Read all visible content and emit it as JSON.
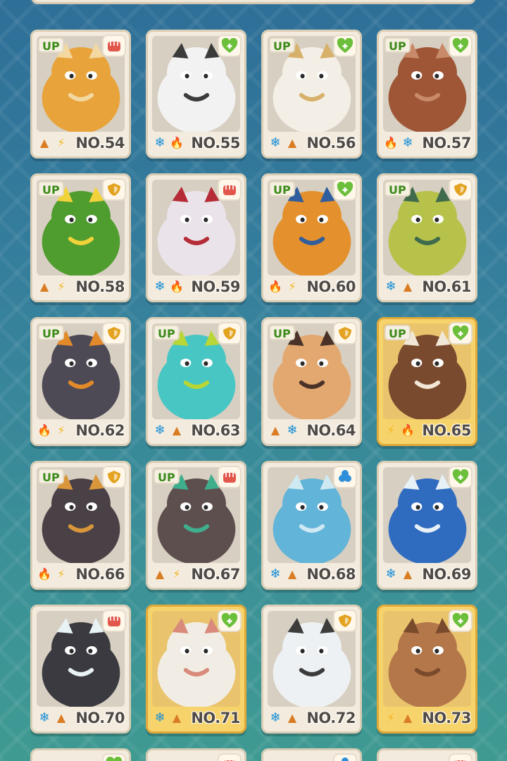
{
  "cards": [
    {
      "num": "NO.54",
      "up": "UP",
      "type": "fist",
      "elems": [
        "ground",
        "electric"
      ],
      "gold": false,
      "body": "#e8a33a",
      "accent": "#f3d8a1"
    },
    {
      "num": "NO.55",
      "up": "",
      "type": "heart",
      "elems": [
        "ice",
        "fire"
      ],
      "gold": false,
      "body": "#f2f2f2",
      "accent": "#3b3b3b"
    },
    {
      "num": "NO.56",
      "up": "UP",
      "type": "heart",
      "elems": [
        "ice",
        "ground"
      ],
      "gold": false,
      "body": "#f4efe6",
      "accent": "#d7b06a"
    },
    {
      "num": "NO.57",
      "up": "UP",
      "type": "heart",
      "elems": [
        "fire",
        "ice"
      ],
      "gold": false,
      "body": "#9e5636",
      "accent": "#c98a6a"
    },
    {
      "num": "NO.58",
      "up": "UP",
      "type": "shield",
      "elems": [
        "ground",
        "electric"
      ],
      "gold": false,
      "body": "#4f9c2f",
      "accent": "#f2d23a"
    },
    {
      "num": "NO.59",
      "up": "",
      "type": "fist",
      "elems": [
        "ice",
        "fire"
      ],
      "gold": false,
      "body": "#eae4ea",
      "accent": "#b52b36"
    },
    {
      "num": "NO.60",
      "up": "UP",
      "type": "heart",
      "elems": [
        "fire",
        "electric"
      ],
      "gold": false,
      "body": "#e4902c",
      "accent": "#2f5d9d"
    },
    {
      "num": "NO.61",
      "up": "UP",
      "type": "shield",
      "elems": [
        "ice",
        "ground"
      ],
      "gold": false,
      "body": "#b6c24a",
      "accent": "#3f6a4c"
    },
    {
      "num": "NO.62",
      "up": "UP",
      "type": "shield",
      "elems": [
        "fire",
        "electric"
      ],
      "gold": false,
      "body": "#4d4a55",
      "accent": "#e28a2a"
    },
    {
      "num": "NO.63",
      "up": "UP",
      "type": "shield",
      "elems": [
        "ice",
        "ground"
      ],
      "gold": false,
      "body": "#48c6c4",
      "accent": "#b8d636"
    },
    {
      "num": "NO.64",
      "up": "UP",
      "type": "shield",
      "elems": [
        "ground",
        "ice"
      ],
      "gold": false,
      "body": "#e3a870",
      "accent": "#4a3228"
    },
    {
      "num": "NO.65",
      "up": "UP",
      "type": "heart",
      "elems": [
        "electric",
        "fire"
      ],
      "gold": true,
      "body": "#7a4a2e",
      "accent": "#f1e7d6"
    },
    {
      "num": "NO.66",
      "up": "UP",
      "type": "shield",
      "elems": [
        "fire",
        "electric"
      ],
      "gold": false,
      "body": "#4a4147",
      "accent": "#d9963a"
    },
    {
      "num": "NO.67",
      "up": "UP",
      "type": "fist",
      "elems": [
        "ground",
        "electric"
      ],
      "gold": false,
      "body": "#5e4f4f",
      "accent": "#3fae8c"
    },
    {
      "num": "NO.68",
      "up": "",
      "type": "drop",
      "elems": [
        "ice",
        "ground"
      ],
      "gold": false,
      "body": "#62b4d8",
      "accent": "#cfe9f3"
    },
    {
      "num": "NO.69",
      "up": "",
      "type": "heart",
      "elems": [
        "ice",
        "ground"
      ],
      "gold": false,
      "body": "#2f6bbf",
      "accent": "#e7f1f6"
    },
    {
      "num": "NO.70",
      "up": "",
      "type": "fist",
      "elems": [
        "ice",
        "ground"
      ],
      "gold": false,
      "body": "#3a3a40",
      "accent": "#e9f3f6"
    },
    {
      "num": "NO.71",
      "up": "",
      "type": "heart",
      "elems": [
        "ice",
        "ground"
      ],
      "gold": true,
      "body": "#f1ede4",
      "accent": "#d98a7a"
    },
    {
      "num": "NO.72",
      "up": "",
      "type": "shield",
      "elems": [
        "ice",
        "ground"
      ],
      "gold": false,
      "body": "#eef1f3",
      "accent": "#3c3c3c"
    },
    {
      "num": "NO.73",
      "up": "",
      "type": "heart",
      "elems": [
        "electric",
        "ground"
      ],
      "gold": true,
      "body": "#b3774a",
      "accent": "#7a4a2c"
    }
  ],
  "partial_row_types": [
    "heart",
    "fist",
    "drop",
    "fist"
  ],
  "icons": {
    "fist": "fist-icon",
    "heart": "heart-plus-icon",
    "shield": "shield-icon",
    "drop": "drop-icon",
    "ice": "snowflake-icon",
    "fire": "fire-icon",
    "ground": "mountain-icon",
    "electric": "lightning-icon"
  },
  "colors": {
    "fist": "#e2574c",
    "heart": "#6bbf3a",
    "shield": "#e3a21f",
    "drop": "#2f8fd8"
  }
}
